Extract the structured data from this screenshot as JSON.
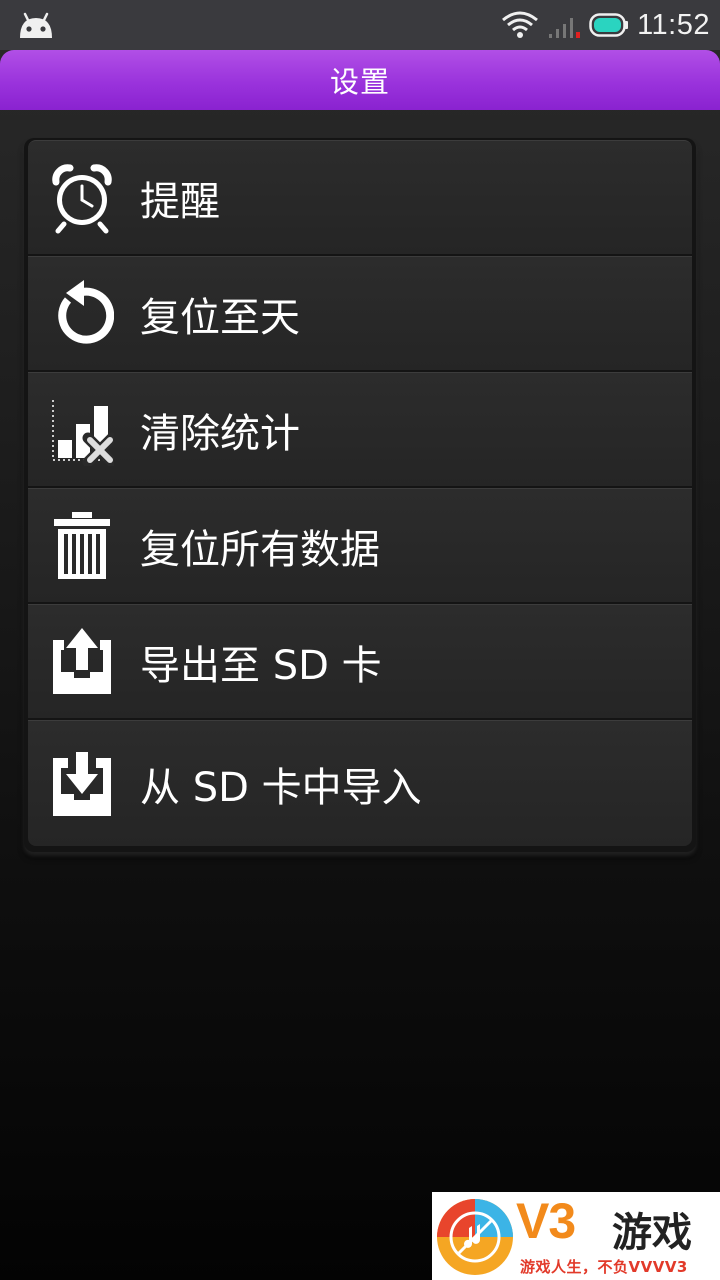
{
  "status_bar": {
    "time": "11:52",
    "icons": [
      "android-icon",
      "wifi-icon",
      "signal-icon",
      "battery-icon"
    ]
  },
  "title_bar": {
    "title": "设置"
  },
  "menu": {
    "items": [
      {
        "label": "提醒",
        "icon": "alarm-clock-icon"
      },
      {
        "label": "复位至天",
        "icon": "reset-arrow-icon"
      },
      {
        "label": "清除统计",
        "icon": "chart-clear-icon"
      },
      {
        "label": "复位所有数据",
        "icon": "trash-icon"
      },
      {
        "label": "导出至 SD 卡",
        "icon": "export-upload-icon"
      },
      {
        "label": "从 SD 卡中导入",
        "icon": "import-download-icon"
      }
    ]
  },
  "watermark": {
    "brand": "V3",
    "name": "游戏",
    "slogan": "游戏人生，不负VVVV3"
  },
  "colors": {
    "title_bar": "#9a33dc",
    "status_bar": "#3a3a3e",
    "battery": "#2ad4c0",
    "watermark_brand": "#f28a1b"
  }
}
